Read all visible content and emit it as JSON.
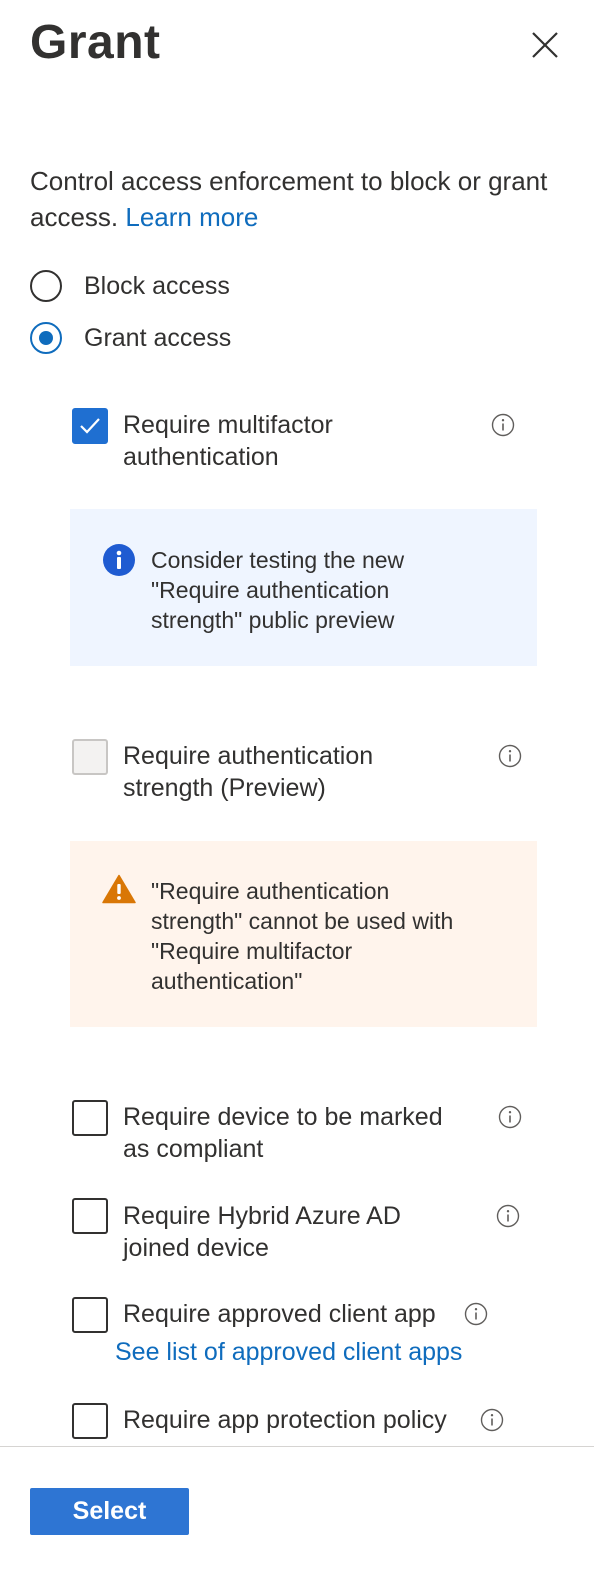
{
  "panel": {
    "title": "Grant",
    "description": "Control access enforcement to block or grant access.",
    "learn_more": "Learn more"
  },
  "access": {
    "options": [
      {
        "label": "Block access",
        "selected": false
      },
      {
        "label": "Grant access",
        "selected": true
      }
    ]
  },
  "controls": {
    "mfa": {
      "label": "Require multifactor authentication",
      "checked": true
    },
    "mfa_info": {
      "text": "Consider testing the new \"Require authentication strength\" public preview"
    },
    "auth_strength": {
      "label": "Require authentication strength (Preview)",
      "checked": false,
      "disabled": true
    },
    "auth_strength_warning": {
      "text": "\"Require authentication strength\" cannot be used with \"Require multifactor authentication\""
    },
    "compliant": {
      "label": "Require device to be marked as compliant",
      "checked": false
    },
    "hybrid": {
      "label": "Require Hybrid Azure AD joined device",
      "checked": false
    },
    "approved_app": {
      "label": "Require approved client app",
      "checked": false,
      "link": "See list of approved client apps"
    },
    "app_protection": {
      "label": "Require app protection policy",
      "checked": false
    }
  },
  "footer": {
    "select_label": "Select"
  },
  "colors": {
    "accent": "#0f6cbd",
    "button": "#2e75d3",
    "info_bg": "#eff5ff",
    "warning_bg": "#fff4ec",
    "warning_icon": "#d97706"
  },
  "icons": [
    "close-icon",
    "info-icon",
    "checkmark-icon",
    "warning-icon"
  ]
}
